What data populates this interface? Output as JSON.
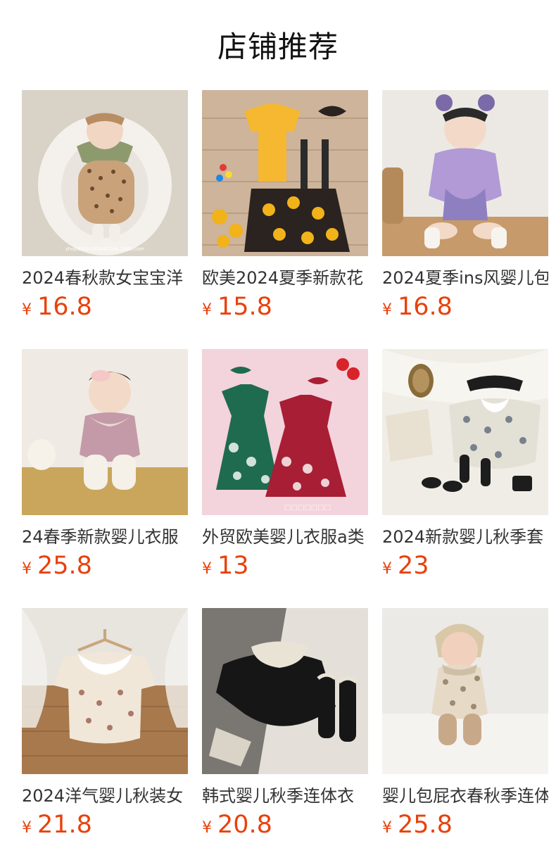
{
  "header": {
    "title": "店铺推荐"
  },
  "products": [
    {
      "name": "2024春秋款女宝宝洋",
      "currency": "¥",
      "price": "16.8",
      "image_icon": "baby-floral-romper-photo"
    },
    {
      "name": "欧美2024夏季新款花",
      "currency": "¥",
      "price": "15.8",
      "image_icon": "sunflower-outfit-photo"
    },
    {
      "name": "2024夏季ins风婴儿包",
      "currency": "¥",
      "price": "16.8",
      "image_icon": "baby-purple-dress-photo"
    },
    {
      "name": "24春季新款婴儿衣服",
      "currency": "¥",
      "price": "25.8",
      "image_icon": "baby-pink-romper-photo"
    },
    {
      "name": "外贸欧美婴儿衣服a类",
      "currency": "¥",
      "price": "13",
      "image_icon": "green-red-dresses-photo"
    },
    {
      "name": "2024新款婴儿秋季套",
      "currency": "¥",
      "price": "23",
      "image_icon": "floral-romper-flatlay-photo"
    },
    {
      "name": "2024洋气婴儿秋装女",
      "currency": "¥",
      "price": "21.8",
      "image_icon": "hanger-floral-romper-photo"
    },
    {
      "name": "韩式婴儿秋季连体衣",
      "currency": "¥",
      "price": "20.8",
      "image_icon": "black-lace-romper-photo"
    },
    {
      "name": "婴儿包屁衣春秋季连体",
      "currency": "¥",
      "price": "25.8",
      "image_icon": "baby-bonnet-romper-photo"
    }
  ],
  "colors": {
    "price": "#e8420c",
    "title": "#111111",
    "name": "#333333"
  }
}
